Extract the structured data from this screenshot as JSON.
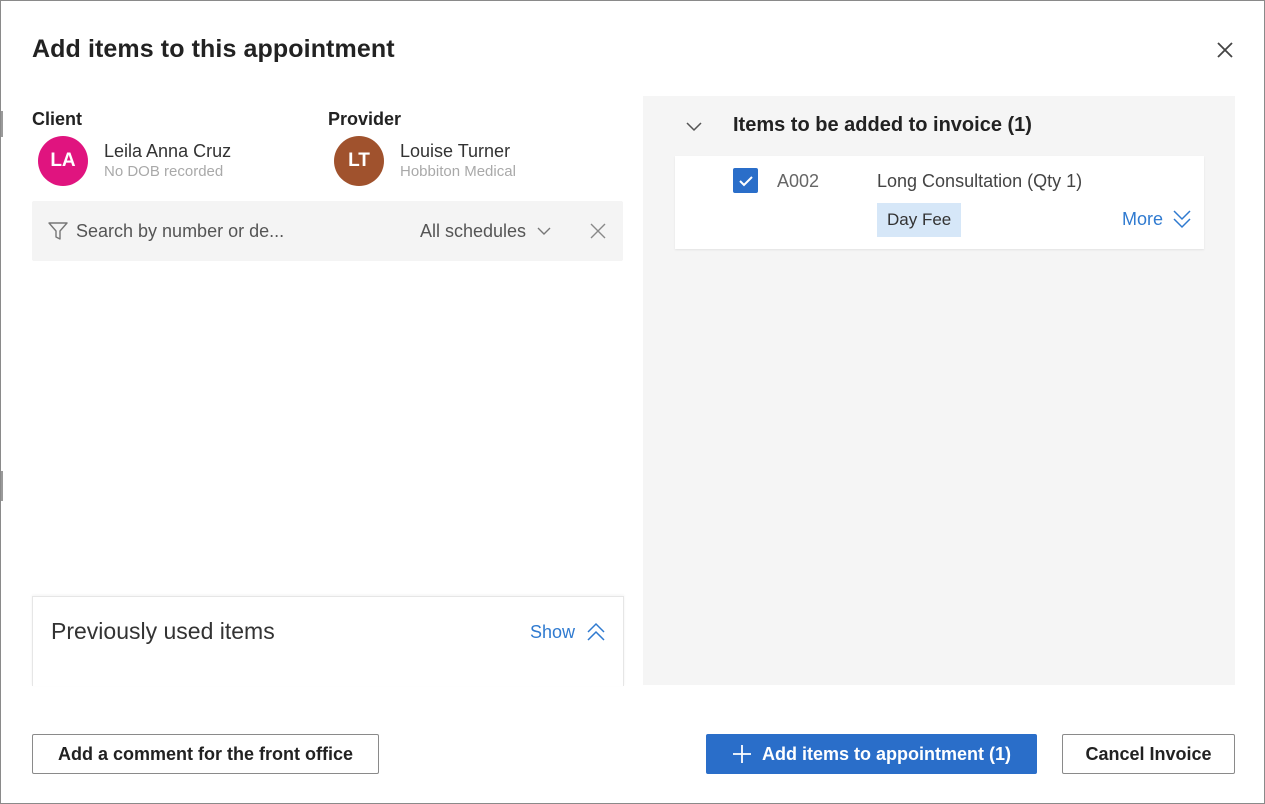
{
  "dialog": {
    "title": "Add items to this appointment"
  },
  "client": {
    "label": "Client",
    "initials": "LA",
    "name": "Leila Anna Cruz",
    "sub": "No DOB recorded",
    "avatar_color": "#e0147f"
  },
  "provider": {
    "label": "Provider",
    "initials": "LT",
    "name": "Louise Turner",
    "sub": "Hobbiton Medical",
    "avatar_color": "#a0522d"
  },
  "search": {
    "placeholder": "Search by number or de...",
    "schedule": "All schedules"
  },
  "previous_items": {
    "title": "Previously used items",
    "toggle_label": "Show"
  },
  "invoice_items": {
    "title": "Items to be added to invoice (1)",
    "items": [
      {
        "checked": true,
        "code": "A002",
        "description": "Long Consultation (Qty 1)",
        "fee": "Day Fee",
        "more_label": "More"
      }
    ]
  },
  "footer": {
    "comment_label": "Add a comment for the front office",
    "add_label": "Add items to appointment (1)",
    "cancel_label": "Cancel Invoice"
  },
  "colors": {
    "primary": "#2a6ec9",
    "link": "#2f7ad0",
    "fee_badge": "#d6e7f8"
  }
}
